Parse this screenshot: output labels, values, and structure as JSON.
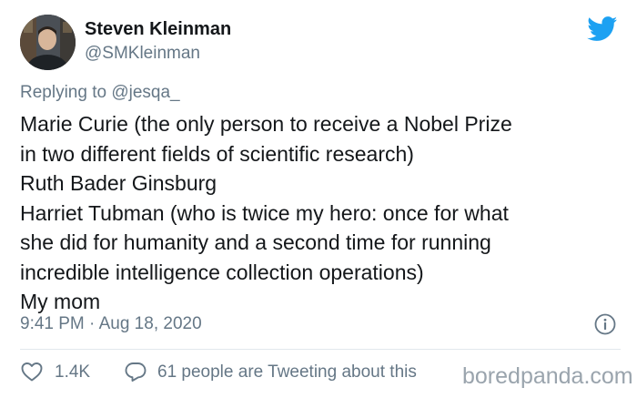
{
  "author": {
    "display_name": "Steven Kleinman",
    "handle": "@SMKleinman"
  },
  "reply": {
    "prefix": "Replying to",
    "mention": "@jesqa_"
  },
  "tweet": {
    "lines": [
      "Marie Curie (the only person to receive a Nobel Prize",
      "in two different fields of scientific research)",
      "Ruth Bader Ginsburg",
      "Harriet Tubman (who is twice my hero: once for what",
      "she did for humanity and a second time for running",
      "incredible intelligence collection operations)",
      "My mom"
    ]
  },
  "meta": {
    "timestamp": "9:41 PM · Aug 18, 2020"
  },
  "actions": {
    "likes": "1.4K",
    "conversation": "61 people are Tweeting about this"
  },
  "watermark": "boredpanda.com",
  "colors": {
    "twitter_blue": "#1da1f2",
    "secondary_text": "#657786",
    "primary_text": "#14171a",
    "divider": "#e1e8ed"
  },
  "icons": [
    "twitter-bird-icon",
    "info-icon",
    "heart-icon",
    "reply-icon"
  ]
}
